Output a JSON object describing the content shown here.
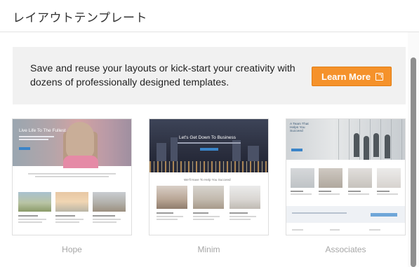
{
  "header": {
    "title": "レイアウトテンプレート"
  },
  "banner": {
    "text": "Save and reuse your layouts or kick-start your creativity with dozens of professionally designed templates.",
    "button_label": "Learn More",
    "button_icon": "external-link-icon",
    "button_color": "#f5922b"
  },
  "templates": [
    {
      "name": "Hope",
      "hero_title": "Live Life To The Fullest"
    },
    {
      "name": "Minim",
      "hero_title": "Let's Get Down To Business",
      "section_title": "We'll Have To Help You Succeed"
    },
    {
      "name": "Associates",
      "hero_title": "A Team That Helps You Succeed"
    }
  ]
}
